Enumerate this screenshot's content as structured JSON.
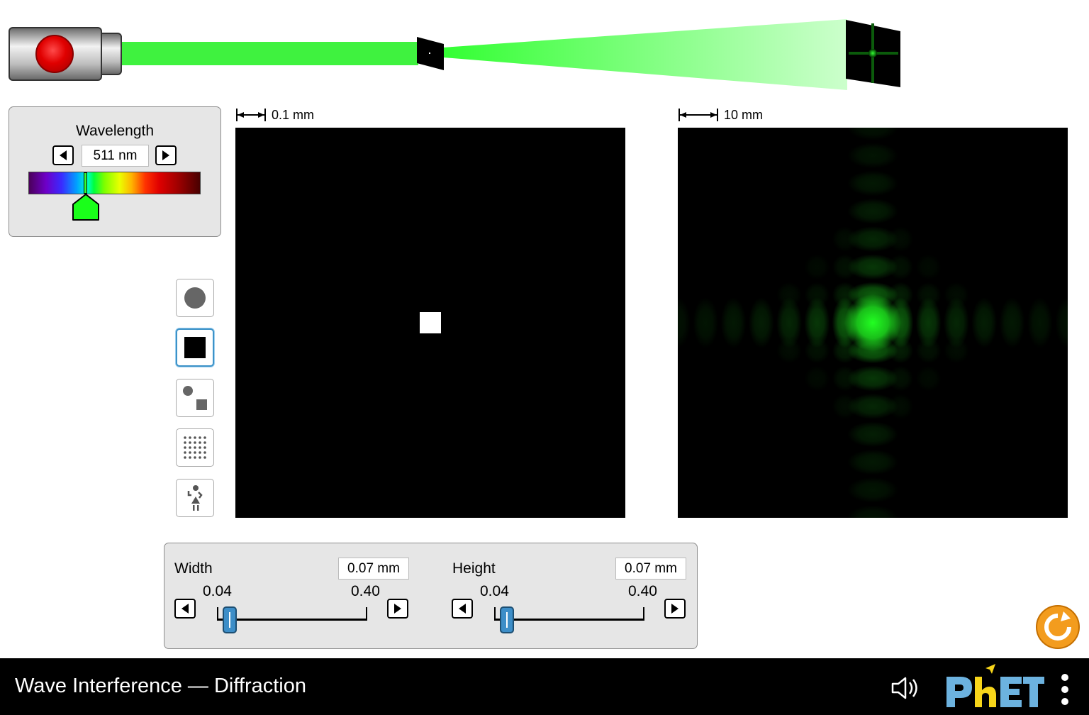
{
  "wavelength_panel": {
    "title": "Wavelength",
    "value": "511 nm",
    "slider_fraction": 0.33,
    "thumb_color": "#1aff1a"
  },
  "aperture_scene": {
    "scale_label": "0.1 mm",
    "aperture_shape": "square",
    "aperture_color": "#ffffff"
  },
  "pattern_scene": {
    "scale_label": "10 mm",
    "beam_color": "#22ff22"
  },
  "aperture_buttons": [
    {
      "name": "circle-aperture",
      "icon": "circle-icon",
      "selected": false
    },
    {
      "name": "square-aperture",
      "icon": "square-icon",
      "selected": true
    },
    {
      "name": "gaussian-aperture",
      "icon": "circle-square-icon",
      "selected": false
    },
    {
      "name": "grid-aperture",
      "icon": "dot-grid-icon",
      "selected": false
    },
    {
      "name": "wave-lady-aperture",
      "icon": "lady-icon",
      "selected": false
    }
  ],
  "controls": {
    "width": {
      "label": "Width",
      "value": "0.07 mm",
      "min_label": "0.04",
      "max_label": "0.40",
      "fraction": 0.083
    },
    "height": {
      "label": "Height",
      "value": "0.07 mm",
      "min_label": "0.04",
      "max_label": "0.40",
      "fraction": 0.083
    }
  },
  "navbar": {
    "title": "Wave Interference — Diffraction",
    "brand": "PhET",
    "sound_icon": "speaker-icon",
    "menu_icon": "kebab-menu-icon"
  },
  "reset": {
    "icon": "reset-icon",
    "color": "#f39c1e"
  }
}
